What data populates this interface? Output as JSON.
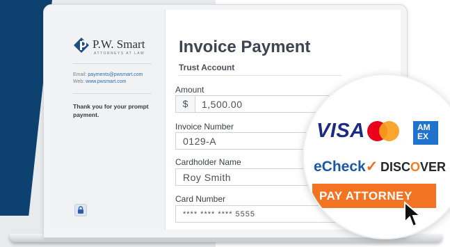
{
  "colors": {
    "accent": "#f27321",
    "brand_blue": "#0d4170",
    "link": "#2c6cb5"
  },
  "sidebar": {
    "logo_name": "P.W. Smart",
    "logo_subtitle": "ATTORNEYS AT LAW",
    "email_label": "Email:",
    "email": "payments@pwsmart.com",
    "web_label": "Web:",
    "web": "www.pwsmart.com",
    "thanks": "Thank you for your prompt payment.",
    "lock_icon": "lock-icon"
  },
  "main": {
    "title": "Invoice Payment",
    "account": "Trust Account",
    "fields": {
      "amount": {
        "label": "Amount",
        "prefix": "$",
        "value": "1,500.00"
      },
      "invoice": {
        "label": "Invoice Number",
        "value": "0129-A"
      },
      "cardholder": {
        "label": "Cardholder Name",
        "value": "Roy Smith"
      },
      "card": {
        "label": "Card Number",
        "value": "**** **** **** 5555"
      }
    }
  },
  "payments": {
    "visa": "VISA",
    "amex_top": "AM",
    "amex_bottom": "EX",
    "echeck_e": "eCheck",
    "discover_a": "DISC",
    "discover_o": "O",
    "discover_b": "VER",
    "button": "PAY ATTORNEY"
  }
}
